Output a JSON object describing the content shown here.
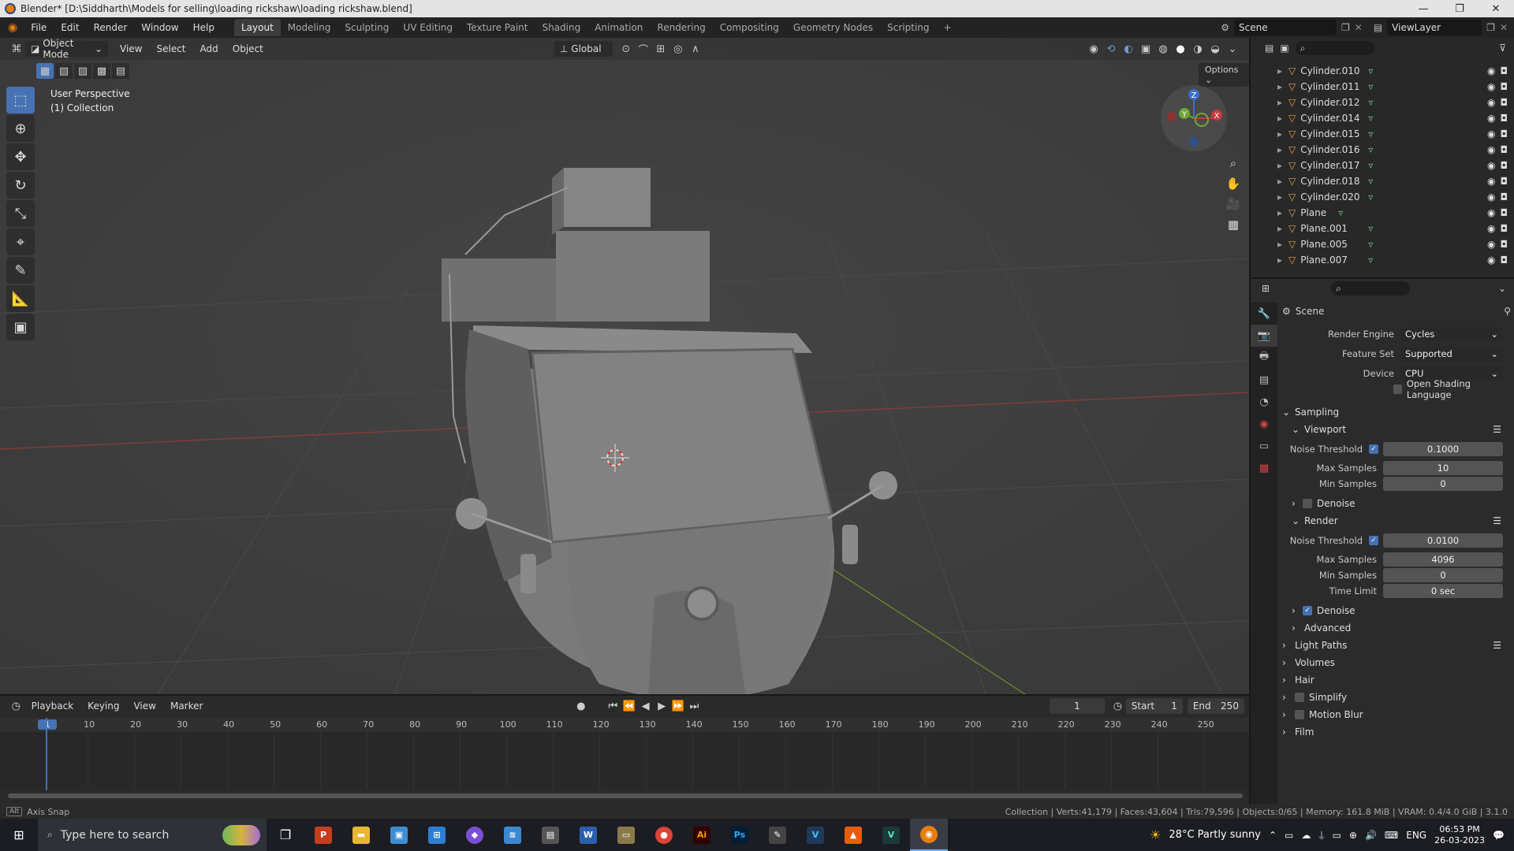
{
  "window": {
    "title": "Blender* [D:\\Siddharth\\Models for selling\\loading rickshaw\\loading rickshaw.blend]",
    "min": "—",
    "max": "❐",
    "close": "✕"
  },
  "menu": {
    "items": [
      "File",
      "Edit",
      "Render",
      "Window",
      "Help"
    ],
    "tabs": [
      "Layout",
      "Modeling",
      "Sculpting",
      "UV Editing",
      "Texture Paint",
      "Shading",
      "Animation",
      "Rendering",
      "Compositing",
      "Geometry Nodes",
      "Scripting"
    ],
    "add_tab": "+",
    "scene": "Scene",
    "view_layer": "ViewLayer"
  },
  "viewport": {
    "mode": "Object Mode",
    "menus": [
      "View",
      "Select",
      "Add",
      "Object"
    ],
    "transform": "Global",
    "options": "Options",
    "perspective": "User Perspective",
    "collection": "(1) Collection",
    "gizmo": {
      "z": "Z",
      "y": "Y",
      "x": "X"
    }
  },
  "outliner": {
    "items": [
      "Cylinder.010",
      "Cylinder.011",
      "Cylinder.012",
      "Cylinder.014",
      "Cylinder.015",
      "Cylinder.016",
      "Cylinder.017",
      "Cylinder.018",
      "Cylinder.020",
      "Plane",
      "Plane.001",
      "Plane.005",
      "Plane.007"
    ]
  },
  "properties": {
    "header": "Scene",
    "render_engine": {
      "label": "Render Engine",
      "value": "Cycles"
    },
    "feature_set": {
      "label": "Feature Set",
      "value": "Supported"
    },
    "device": {
      "label": "Device",
      "value": "CPU"
    },
    "osl": "Open Shading Language",
    "sampling": "Sampling",
    "viewport_section": "Viewport",
    "vp_noise": {
      "label": "Noise Threshold",
      "value": "0.1000"
    },
    "vp_max": {
      "label": "Max Samples",
      "value": "10"
    },
    "vp_min": {
      "label": "Min Samples",
      "value": "0"
    },
    "vp_denoise": "Denoise",
    "render_section": "Render",
    "r_noise": {
      "label": "Noise Threshold",
      "value": "0.0100"
    },
    "r_max": {
      "label": "Max Samples",
      "value": "4096"
    },
    "r_min": {
      "label": "Min Samples",
      "value": "0"
    },
    "r_time": {
      "label": "Time Limit",
      "value": "0 sec"
    },
    "r_denoise": "Denoise",
    "advanced": "Advanced",
    "light_paths": "Light Paths",
    "volumes": "Volumes",
    "hair": "Hair",
    "simplify": "Simplify",
    "motion_blur": "Motion Blur",
    "film": "Film"
  },
  "timeline": {
    "menus": [
      "Playback",
      "Keying",
      "View",
      "Marker"
    ],
    "current_frame": "1",
    "start_label": "Start",
    "start": "1",
    "end_label": "End",
    "end": "250",
    "ticks": [
      "1",
      "10",
      "20",
      "30",
      "40",
      "50",
      "60",
      "70",
      "80",
      "90",
      "100",
      "110",
      "120",
      "130",
      "140",
      "150",
      "160",
      "170",
      "180",
      "190",
      "200",
      "210",
      "220",
      "230",
      "240",
      "250"
    ]
  },
  "status": {
    "left": "Axis Snap",
    "right": "Collection | Verts:41,179 | Faces:43,604 | Tris:79,596 | Objects:0/65 | Memory: 161.8 MiB | VRAM: 0.4/4.0 GiB | 3.1.0"
  },
  "taskbar": {
    "search": "Type here to search",
    "weather": "28°C  Partly sunny",
    "lang": "ENG",
    "time": "06:53 PM",
    "date": "26-03-2023"
  }
}
